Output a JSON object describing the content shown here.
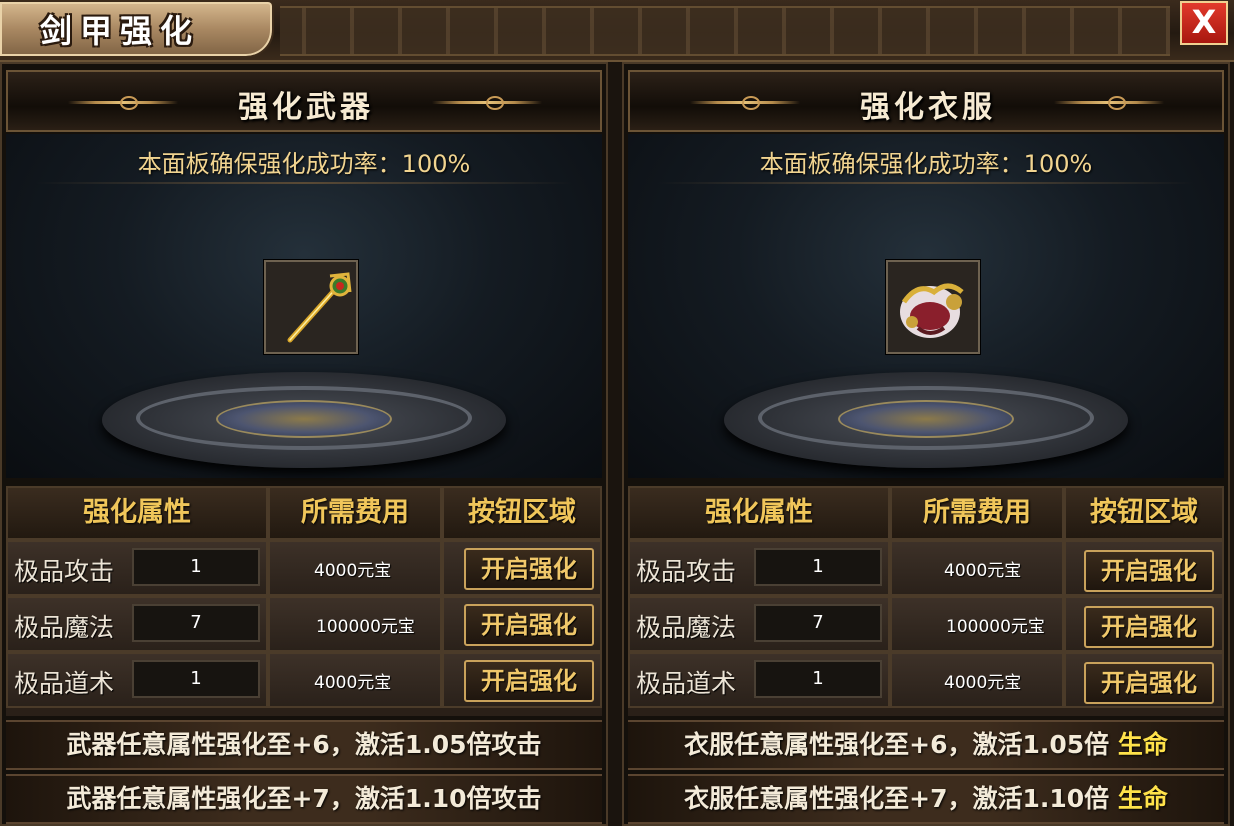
{
  "window": {
    "title": "剑甲强化",
    "close_label": "X"
  },
  "panels": [
    {
      "title": "强化武器",
      "success_rate": "本面板确保强化成功率：100%",
      "item_icon": "golden-staff-icon",
      "headers": [
        "强化属性",
        "所需费用",
        "按钮区域"
      ],
      "rows": [
        {
          "attr": "极品攻击",
          "level": "1",
          "cost": "4000元宝",
          "button": "开启强化"
        },
        {
          "attr": "极品魔法",
          "level": "7",
          "cost": "100000元宝",
          "button": "开启强化"
        },
        {
          "attr": "极品道术",
          "level": "1",
          "cost": "4000元宝",
          "button": "开启强化"
        }
      ],
      "bonuses": [
        {
          "text": "武器任意属性强化至+6，激活1.05倍攻击",
          "highlight": ""
        },
        {
          "text": "武器任意属性强化至+7，激活1.10倍攻击",
          "highlight": ""
        }
      ]
    },
    {
      "title": "强化衣服",
      "success_rate": "本面板确保强化成功率：100%",
      "item_icon": "armor-icon",
      "headers": [
        "强化属性",
        "所需费用",
        "按钮区域"
      ],
      "rows": [
        {
          "attr": "极品攻击",
          "level": "1",
          "cost": "4000元宝",
          "button": "开启强化"
        },
        {
          "attr": "极品魔法",
          "level": "7",
          "cost": "100000元宝",
          "button": "开启强化"
        },
        {
          "attr": "极品道术",
          "level": "1",
          "cost": "4000元宝",
          "button": "开启强化"
        }
      ],
      "bonuses": [
        {
          "text": "衣服任意属性强化至+6，激活1.05倍 ",
          "highlight": "生命"
        },
        {
          "text": "衣服任意属性强化至+7，激活1.10倍 ",
          "highlight": "生命"
        }
      ]
    }
  ],
  "colors": {
    "header_gold": "#f0c65a",
    "rate_gold": "#f1d490",
    "highlight_yellow": "#ffe24a",
    "close_red": "#d22a1f"
  }
}
